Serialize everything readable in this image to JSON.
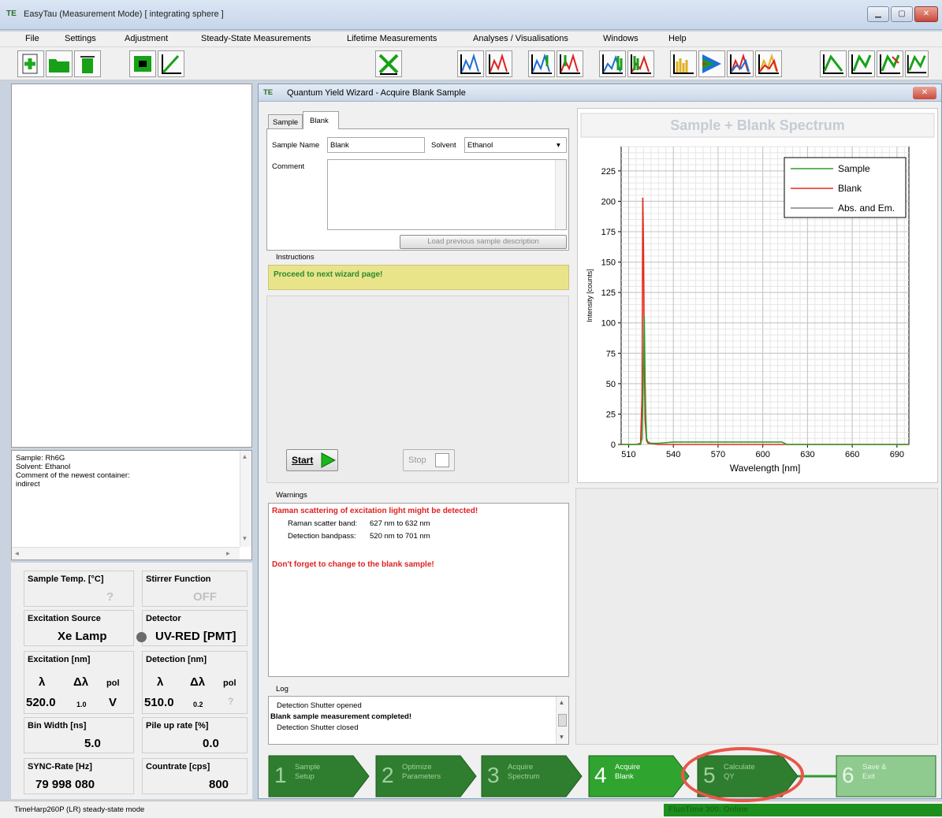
{
  "window": {
    "title": "EasyTau  (Measurement Mode)   [ integrating sphere ]",
    "app_icon": "TE"
  },
  "menu": [
    "File",
    "Settings",
    "Adjustment",
    "Steady-State Measurements",
    "Lifetime Measurements",
    "Analyses / Visualisations",
    "Windows",
    "Help"
  ],
  "toolbar_icons": [
    "new-icon",
    "open-folder-icon",
    "recycle-bin-icon",
    "align-icon",
    "decay-icon",
    "tools-icon",
    "spectrum-icon",
    "spectrum-red-icon",
    "spectrum-multi-icon",
    "spectrum-multi-red-icon",
    "spectrum-stack-icon",
    "spectrum-stack-red-icon",
    "bars-icon",
    "triangle-map-icon",
    "overlay-icon",
    "overlay-red-icon",
    "decay-fit-icon",
    "decay-fit-green-icon",
    "decay-fit-multi-icon",
    "decay-fit-green-2-icon"
  ],
  "info_panel": {
    "lines": [
      "Sample: Rh6G",
      "Solvent: Ethanol",
      "Comment of the newest container:",
      "indirect"
    ]
  },
  "status_panel": {
    "sample_temp_label": "Sample Temp. [°C]",
    "sample_temp_value": "?",
    "stirrer_label": "Stirrer Function",
    "stirrer_value": "OFF",
    "excitation_source_label": "Excitation Source",
    "excitation_source_value": "Xe Lamp",
    "detector_label": "Detector",
    "detector_value": "UV-RED [PMT]",
    "excitation_label": "Excitation  [nm]",
    "detection_label": "Detection  [nm]",
    "lambda": "λ",
    "dlambda": "Δλ",
    "pol": "pol",
    "exc_lambda": "520.0",
    "exc_dlambda": "1.0",
    "exc_pol": "V",
    "det_lambda": "510.0",
    "det_dlambda": "0.2",
    "det_pol": "?",
    "binwidth_label": "Bin Width  [ns]",
    "binwidth_value": "5.0",
    "pileup_label": "Pile up rate  [%]",
    "pileup_value": "0.0",
    "sync_label": "SYNC-Rate  [Hz]",
    "sync_value": "79 998 080",
    "countrate_label": "Countrate  [cps]",
    "countrate_value": "800"
  },
  "wizard": {
    "title": "Quantum Yield Wizard  -  Acquire Blank Sample",
    "tabs": [
      "Sample",
      "Blank"
    ],
    "sample_name_label": "Sample Name",
    "sample_name_value": "Blank",
    "solvent_label": "Solvent",
    "solvent_value": "Ethanol",
    "comment_label": "Comment",
    "load_button": "Load previous sample description",
    "instructions_label": "Instructions",
    "instructions_text": "Proceed to next wizard page!",
    "start_button": "Start",
    "stop_button": "Stop",
    "warnings_label": "Warnings",
    "warning_title": "Raman scattering of excitation light might be detected!",
    "raman_label": "Raman scatter band:",
    "raman_value": "627 nm to 632 nm",
    "bandpass_label": "Detection bandpass:",
    "bandpass_value": "520 nm to 701 nm",
    "warning_blank": "Don't forget to change to the blank sample!",
    "log_label": "Log",
    "log_lines": [
      "Detection Shutter opened",
      "Blank sample measurement completed!",
      "Detection Shutter closed"
    ],
    "steps": [
      {
        "num": "1",
        "label": "Sample\nSetup"
      },
      {
        "num": "2",
        "label": "Optimize\nParameters"
      },
      {
        "num": "3",
        "label": "Acquire\nSpectrum"
      },
      {
        "num": "4",
        "label": "Acquire\nBlank"
      },
      {
        "num": "5",
        "label": "Calculate\nQY"
      },
      {
        "num": "6",
        "label": "Save &\nExit"
      }
    ]
  },
  "status_bar": {
    "left": "TimeHarp260P (LR) steady-state mode",
    "right": "FluoTime 300: Online"
  },
  "colors": {
    "sample": "#2e9d2e",
    "blank": "#e52b1e",
    "abs_em": "#808080",
    "step_active": "#2fa52f",
    "step_dim": "#2f7e2f",
    "highlight_ring": "#e8574a",
    "instructions_bg": "#e9e48a"
  },
  "chart_data": {
    "type": "line",
    "title": "Sample + Blank Spectrum",
    "xlabel": "Wavelength [nm]",
    "ylabel": "Intensity [counts]",
    "xlim": [
      505,
      698
    ],
    "ylim": [
      0,
      245
    ],
    "xticks": [
      510,
      540,
      570,
      600,
      630,
      660,
      690
    ],
    "yticks": [
      0,
      25,
      50,
      75,
      100,
      125,
      150,
      175,
      200,
      225
    ],
    "grid": true,
    "legend_position": "top-right",
    "series": [
      {
        "name": "Sample",
        "color": "#2e9d2e",
        "x": [
          505,
          515,
          518,
          519,
          520,
          520.5,
          521,
          521.5,
          522,
          523,
          525,
          530,
          540,
          560,
          580,
          600,
          610,
          613,
          616,
          630,
          698
        ],
        "y": [
          0,
          0,
          0,
          5,
          65,
          105,
          55,
          25,
          5,
          2,
          1,
          1,
          2,
          2,
          2,
          2,
          2,
          2,
          0,
          0,
          0
        ]
      },
      {
        "name": "Blank",
        "color": "#e52b1e",
        "x": [
          505,
          515,
          518,
          519,
          519.5,
          520,
          520.5,
          521,
          522,
          523,
          530,
          560,
          600,
          640,
          698
        ],
        "y": [
          0,
          0,
          1,
          40,
          203,
          160,
          80,
          20,
          3,
          1,
          0,
          0,
          0,
          0,
          0
        ]
      },
      {
        "name": "Abs. and Em.",
        "color": "#808080",
        "x": [],
        "y": []
      }
    ]
  }
}
